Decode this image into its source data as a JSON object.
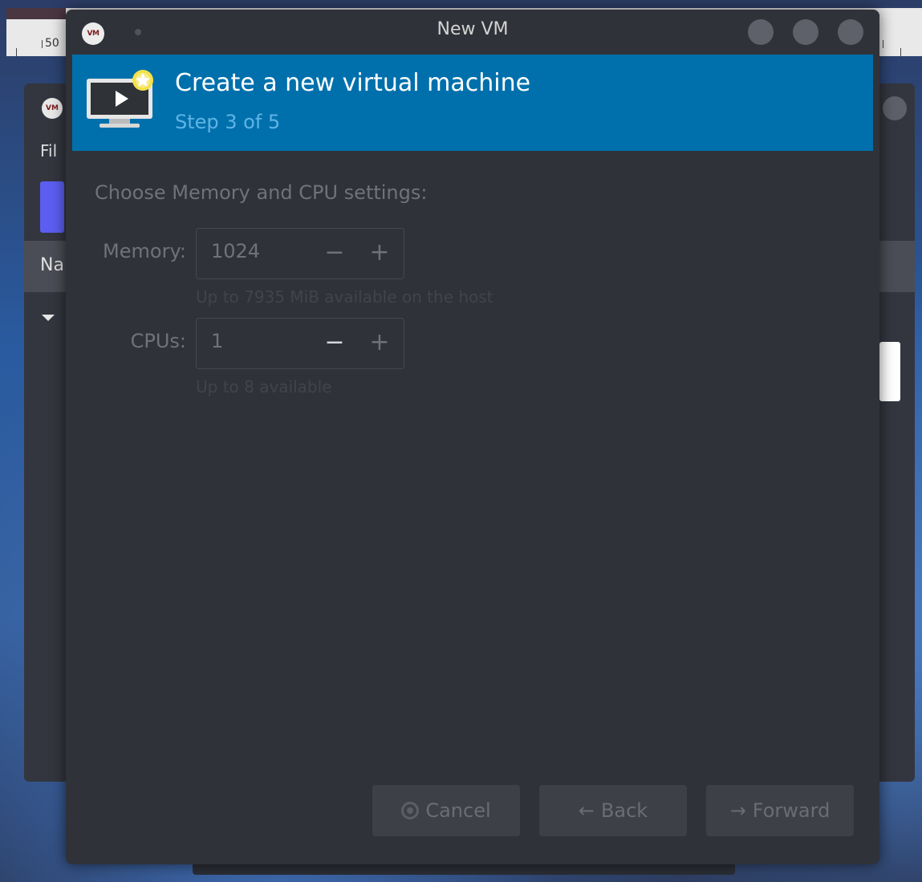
{
  "background": {
    "ruler_label": "50",
    "menu_file": "Fil",
    "header_name": "Na"
  },
  "dialog": {
    "title": "New VM",
    "logo_text": "VM",
    "icons": {
      "logo": "vm-logo-icon",
      "banner": "monitor-play-star-icon"
    },
    "banner": {
      "title": "Create a new virtual machine",
      "step": "Step 3 of 5",
      "color": "#0070ac"
    },
    "section_label": "Choose Memory and CPU settings:",
    "memory": {
      "label": "Memory:",
      "value": "1024",
      "hint": "Up to 7935 MiB available on the host"
    },
    "cpus": {
      "label": "CPUs:",
      "value": "1",
      "hint": "Up to 8 available"
    },
    "buttons": {
      "cancel": "Cancel",
      "back": "Back",
      "forward": "Forward"
    }
  }
}
